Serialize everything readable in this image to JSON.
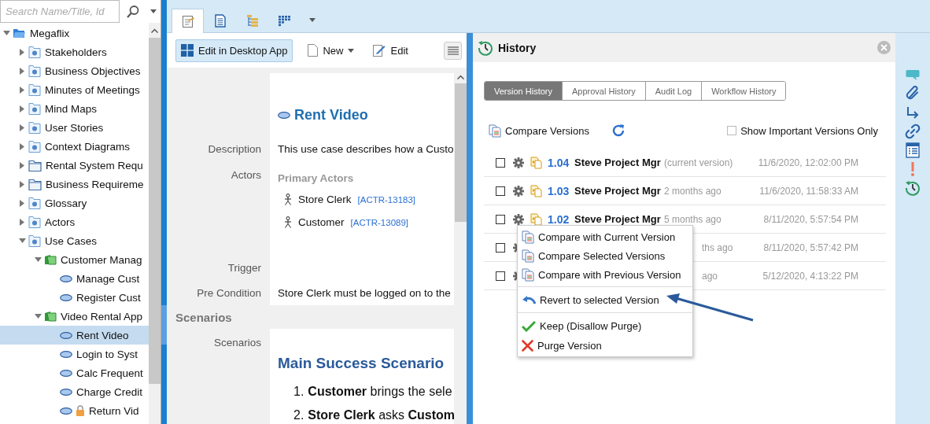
{
  "search": {
    "placeholder": "Search Name/Title, Id"
  },
  "tree": [
    {
      "label": "Megaflix",
      "kind": "root",
      "expanded": true,
      "selected": false,
      "children": [
        {
          "label": "Stakeholders",
          "kind": "category",
          "expanded": false,
          "selected": false
        },
        {
          "label": "Business Objectives",
          "kind": "category",
          "expanded": false,
          "selected": false
        },
        {
          "label": "Minutes of Meetings",
          "kind": "category",
          "expanded": false,
          "selected": false
        },
        {
          "label": "Mind Maps",
          "kind": "category",
          "expanded": false,
          "selected": false
        },
        {
          "label": "User Stories",
          "kind": "category",
          "expanded": false,
          "selected": false
        },
        {
          "label": "Context Diagrams",
          "kind": "category",
          "expanded": false,
          "selected": false
        },
        {
          "label": "Rental System Requ",
          "kind": "folder",
          "expanded": false,
          "selected": false
        },
        {
          "label": "Business Requireme",
          "kind": "folder",
          "expanded": false,
          "selected": false
        },
        {
          "label": "Glossary",
          "kind": "category",
          "expanded": false,
          "selected": false
        },
        {
          "label": "Actors",
          "kind": "category",
          "expanded": false,
          "selected": false
        },
        {
          "label": "Use Cases",
          "kind": "category",
          "expanded": true,
          "selected": false,
          "children": [
            {
              "label": "Customer Manag",
              "kind": "package",
              "expanded": true,
              "selected": false,
              "children": [
                {
                  "label": "Manage Cust",
                  "kind": "usecase",
                  "locked": false,
                  "selected": false
                },
                {
                  "label": "Register Cust",
                  "kind": "usecase",
                  "locked": false,
                  "selected": false
                }
              ]
            },
            {
              "label": "Video Rental App",
              "kind": "package",
              "expanded": true,
              "selected": false,
              "children": [
                {
                  "label": "Rent Video",
                  "kind": "usecase",
                  "locked": false,
                  "selected": true
                },
                {
                  "label": "Login to Syst",
                  "kind": "usecase",
                  "locked": false,
                  "selected": false
                },
                {
                  "label": "Calc Frequent",
                  "kind": "usecase",
                  "locked": false,
                  "selected": false
                },
                {
                  "label": "Charge Credit",
                  "kind": "usecase",
                  "locked": false,
                  "selected": false
                },
                {
                  "label": "Return Vid",
                  "kind": "usecase",
                  "locked": true,
                  "selected": false
                }
              ]
            }
          ]
        }
      ]
    }
  ],
  "view_tabs": [
    {
      "kind": "details",
      "selected": true
    },
    {
      "kind": "document",
      "selected": false
    },
    {
      "kind": "tree",
      "selected": false
    },
    {
      "kind": "grid",
      "selected": false
    }
  ],
  "toolbar": {
    "desktop": "Edit in Desktop App",
    "new": "New",
    "edit": "Edit"
  },
  "item": {
    "title": "Rent Video",
    "fields": [
      {
        "kind": "text",
        "label": "Description",
        "value": "This use case describes how a Custo"
      },
      {
        "kind": "actors",
        "label": "Actors",
        "group": "Primary Actors",
        "actors": [
          {
            "name": "Store Clerk",
            "id": "[ACTR-13183]"
          },
          {
            "name": "Customer",
            "id": "[ACTR-13089]"
          }
        ]
      },
      {
        "kind": "empty",
        "label": "Trigger"
      },
      {
        "kind": "text",
        "label": "Pre Condition",
        "value": "Store Clerk must be logged on to the"
      },
      {
        "kind": "section",
        "label": "Scenarios"
      },
      {
        "kind": "scenarios",
        "label": "Scenarios",
        "heading": "Main Success Scenario",
        "steps": [
          {
            "number": "1.",
            "text": "**Customer** brings the sele"
          },
          {
            "number": "2.",
            "text": "**Store Clerk** asks **Custom**"
          }
        ]
      }
    ]
  },
  "history": {
    "title": "History",
    "tabs": [
      {
        "label": "Version History",
        "selected": true
      },
      {
        "label": "Approval History",
        "selected": false
      },
      {
        "label": "Audit Log",
        "selected": false
      },
      {
        "label": "Workflow History",
        "selected": false
      }
    ],
    "compare": "Compare Versions",
    "important": {
      "label": "Show Important Versions Only",
      "checked": false
    },
    "rows": [
      {
        "kind": "full",
        "checked": false,
        "version": "1.04",
        "author": "Steve Project Mgr",
        "relative": "(current version)",
        "date": "11/6/2020, 12:02:00 PM"
      },
      {
        "kind": "full",
        "checked": false,
        "version": "1.03",
        "author": "Steve Project Mgr",
        "relative": "2 months ago",
        "date": "11/6/2020, 11:58:33 AM"
      },
      {
        "kind": "full",
        "checked": false,
        "version": "1.02",
        "author": "Steve Project Mgr",
        "relative": "5 months ago",
        "date": "8/11/2020, 5:57:54 PM"
      },
      {
        "kind": "covered",
        "checked": false,
        "relative": "ths ago",
        "date": "8/11/2020, 5:57:42 PM"
      },
      {
        "kind": "covered",
        "checked": false,
        "relative": "ago",
        "date": "5/12/2020, 4:13:22 PM"
      }
    ],
    "menu": [
      {
        "kind": "compare",
        "label": "Compare with Current Version",
        "divider_before": false
      },
      {
        "kind": "compare",
        "label": "Compare Selected Versions",
        "divider_before": false
      },
      {
        "kind": "compare",
        "label": "Compare with Previous Version",
        "divider_before": false
      },
      {
        "kind": "revert",
        "label": "Revert to selected Version",
        "divider_before": true
      },
      {
        "kind": "keep",
        "label": "Keep (Disallow Purge)",
        "divider_before": true
      },
      {
        "kind": "purge",
        "label": "Purge Version",
        "divider_before": false
      }
    ]
  },
  "side_icons": [
    {
      "kind": "comment"
    },
    {
      "kind": "attachment"
    },
    {
      "kind": "trace"
    },
    {
      "kind": "link"
    },
    {
      "kind": "table"
    },
    {
      "kind": "alert"
    },
    {
      "kind": "history"
    }
  ]
}
